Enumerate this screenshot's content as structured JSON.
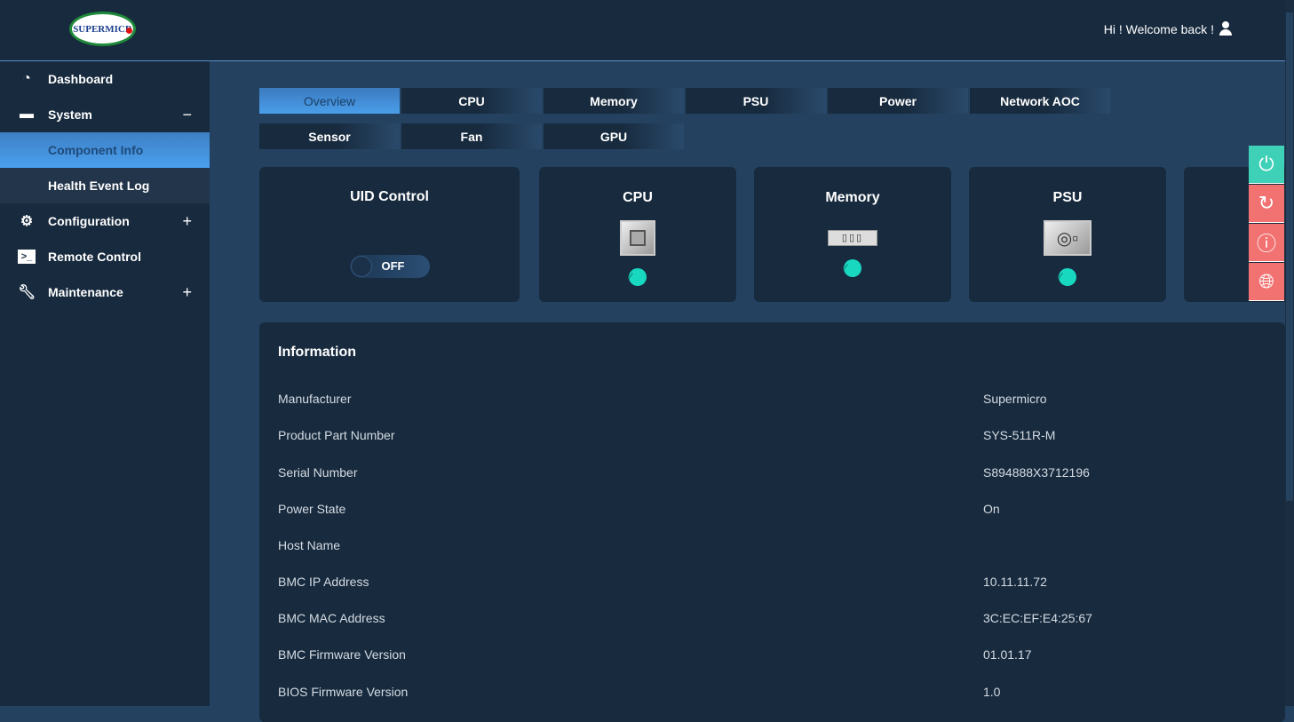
{
  "header": {
    "logo_text": "SUPERMICRO",
    "welcome": "Hi ! Welcome back !"
  },
  "sidebar": {
    "items": [
      {
        "label": "Dashboard",
        "toggle": ""
      },
      {
        "label": "System",
        "toggle": "−"
      },
      {
        "label": "Component Info"
      },
      {
        "label": "Health Event Log"
      },
      {
        "label": "Configuration",
        "toggle": "+"
      },
      {
        "label": "Remote Control",
        "toggle": ""
      },
      {
        "label": "Maintenance",
        "toggle": "+"
      }
    ]
  },
  "tabs": [
    "Overview",
    "CPU",
    "Memory",
    "PSU",
    "Power",
    "Network AOC",
    "Sensor",
    "Fan",
    "GPU"
  ],
  "cards": {
    "uid": {
      "title": "UID Control",
      "state": "OFF"
    },
    "cpu": {
      "title": "CPU"
    },
    "memory": {
      "title": "Memory"
    },
    "psu": {
      "title": "PSU"
    }
  },
  "info": {
    "title": "Information",
    "rows": [
      {
        "label": "Manufacturer",
        "value": "Supermicro"
      },
      {
        "label": "Product Part Number",
        "value": "SYS-511R-M"
      },
      {
        "label": "Serial Number",
        "value": "S894888X3712196"
      },
      {
        "label": "Power State",
        "value": "On"
      },
      {
        "label": "Host Name",
        "value": ""
      },
      {
        "label": "BMC IP Address",
        "value": "10.11.11.72"
      },
      {
        "label": "BMC MAC Address",
        "value": "3C:EC:EF:E4:25:67"
      },
      {
        "label": "BMC Firmware Version",
        "value": "01.01.17"
      },
      {
        "label": "BIOS Firmware Version",
        "value": "1.0"
      }
    ]
  },
  "colors": {
    "accent": "#4a9eea",
    "ok": "#18d8c0",
    "power": "#3fd0b8",
    "action": "#f27272"
  }
}
